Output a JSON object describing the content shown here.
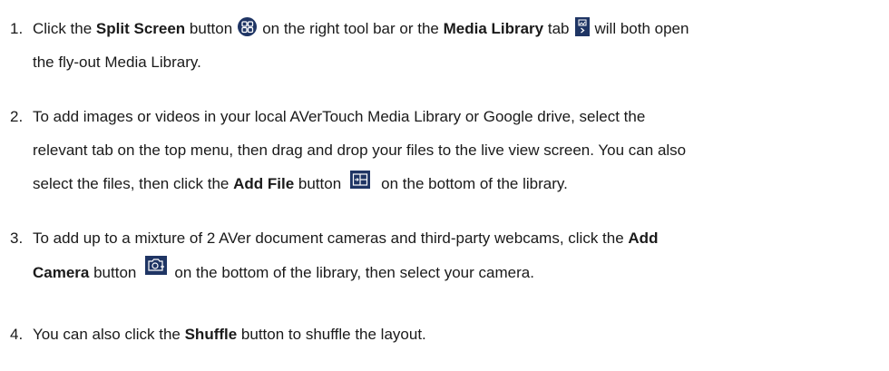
{
  "steps": [
    {
      "number": "1.",
      "line1_a": "Click the ",
      "line1_b": "Split Screen",
      "line1_c": " button",
      "line1_d": "on the right tool bar or the ",
      "line1_e": "Media Library",
      "line1_f": " tab",
      "line1_g": "will both open",
      "line2": "the fly-out Media Library."
    },
    {
      "number": "2.",
      "line1": "To add images or videos in your local AVerTouch Media Library or Google drive, select the",
      "line2": "relevant tab on the top menu, then drag and drop your files to the live view screen. You can also",
      "line3_a": "select the files, then click the ",
      "line3_b": "Add File",
      "line3_c": " button",
      "line3_d": "on the bottom of the library."
    },
    {
      "number": "3.",
      "line1_a": "To add up to a mixture of 2 AVer document cameras and third-party webcams, click the ",
      "line1_b": "Add",
      "line2_a": "Camera",
      "line2_b": " button",
      "line2_c": "on the bottom of the library, then select your camera."
    },
    {
      "number": "4.",
      "line1_a": " You can also click the ",
      "line1_b": "Shuffle",
      "line1_c": " button to shuffle the layout."
    }
  ],
  "icons": {
    "split_screen": "split-screen-icon",
    "media_library": "media-library-icon",
    "add_file": "add-file-icon",
    "add_camera": "add-camera-icon"
  },
  "colors": {
    "icon_bg": "#1f3564",
    "text": "#1a1a1a"
  }
}
